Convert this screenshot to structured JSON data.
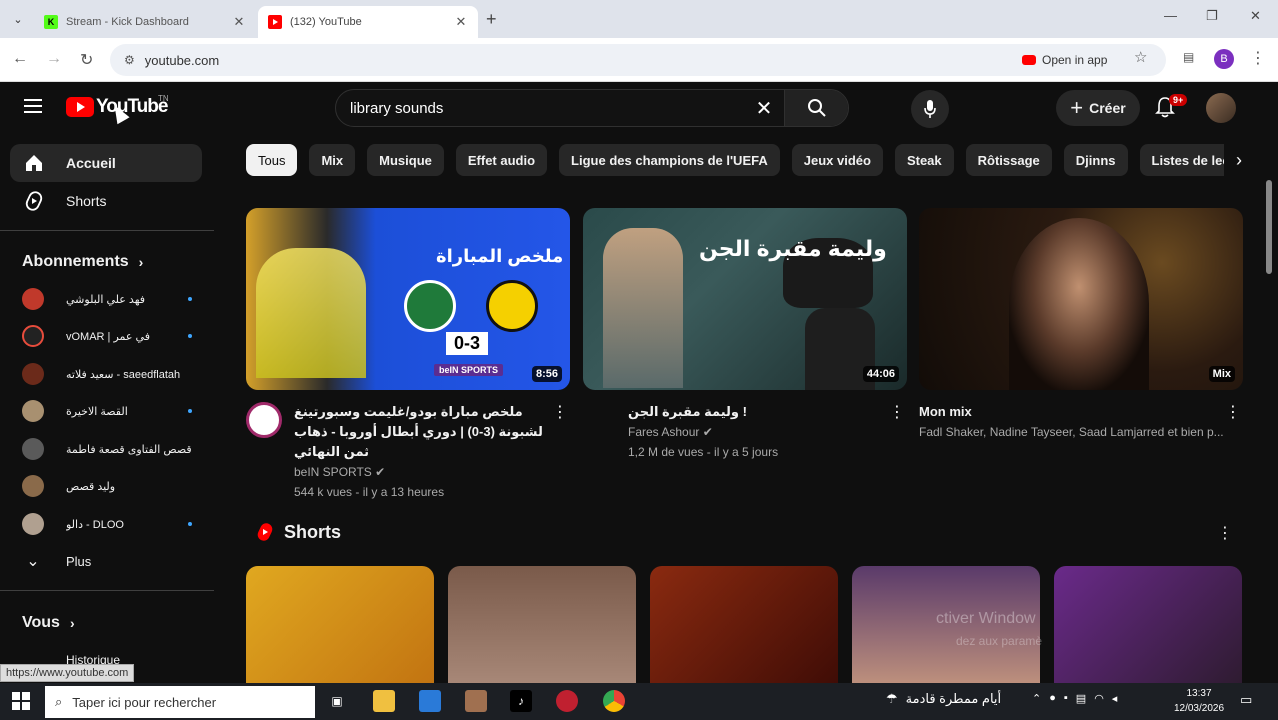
{
  "browser": {
    "tabs": [
      {
        "title": "Stream - Kick Dashboard",
        "favicon": "K",
        "active": false
      },
      {
        "title": "(132) YouTube",
        "active": true
      }
    ],
    "url": "youtube.com",
    "open_in_app": "Open in app",
    "profile_letter": "B"
  },
  "youtube": {
    "logo_text": "YouTube",
    "region": "TN",
    "search_value": "library sounds",
    "create_label": "Créer",
    "notif_count": "9+",
    "sidebar": {
      "home": "Accueil",
      "shorts": "Shorts",
      "subs_header": "Abonnements",
      "subs": [
        {
          "name": "فهد علي البلوشي",
          "color": "#c0392b",
          "dot": true
        },
        {
          "name": "vOMAR | في عمر",
          "color": "#e74c3c",
          "dot": true
        },
        {
          "name": "سعيد فلاته - saeedflatah",
          "color": "#6b2a1a",
          "dot": false
        },
        {
          "name": "القصة الاخيرة",
          "color": "#a89070",
          "dot": true
        },
        {
          "name": "قصص الفتاوى قصعة فاطمة",
          "color": "#5a5a5a",
          "dot": false
        },
        {
          "name": "وليد قصص",
          "color": "#8a6a4a",
          "dot": false
        },
        {
          "name": "دالو - DLOO",
          "color": "#b0a090",
          "dot": true
        }
      ],
      "more": "Plus",
      "you_header": "Vous",
      "history": "Historique",
      "status_url": "https://www.youtube.com"
    },
    "chips": [
      "Tous",
      "Mix",
      "Musique",
      "Effet audio",
      "Ligue des champions de l'UEFA",
      "Jeux vidéo",
      "Steak",
      "Rôtissage",
      "Djinns",
      "Listes de lecture"
    ],
    "videos": [
      {
        "title": "ملخص مباراة بودو/غليمت وسبورتينغ لشبونة (3-0) | دوري أبطال أوروبا - ذهاب ثمن النهائي",
        "channel": "beIN SPORTS",
        "stats": "544 k vues - il y a 13 heures",
        "duration": "8:56",
        "thumb_heading": "ملخص المباراة",
        "thumb_score": "0-3",
        "thumb_brand": "beIN SPORTS"
      },
      {
        "title": "وليمة مقبرة الجن !",
        "channel": "Fares Ashour",
        "stats": "1,2 M de vues - il y a 5 jours",
        "duration": "44:06",
        "thumb_heading": "وليمة مقبرة الجن"
      },
      {
        "title": "Mon mix",
        "channel": "Fadl Shaker, Nadine Tayseer, Saad Lamjarred et bien p...",
        "stats": "",
        "duration": "Mix"
      }
    ],
    "shorts_title": "Shorts"
  },
  "watermark": {
    "line1": "ctiver Window",
    "line2": "dez aux paramè"
  },
  "taskbar": {
    "search_placeholder": "Taper ici pour rechercher",
    "weather": "أيام ممطرة قادمة",
    "time": "13:37",
    "date": "12/03/2026"
  }
}
